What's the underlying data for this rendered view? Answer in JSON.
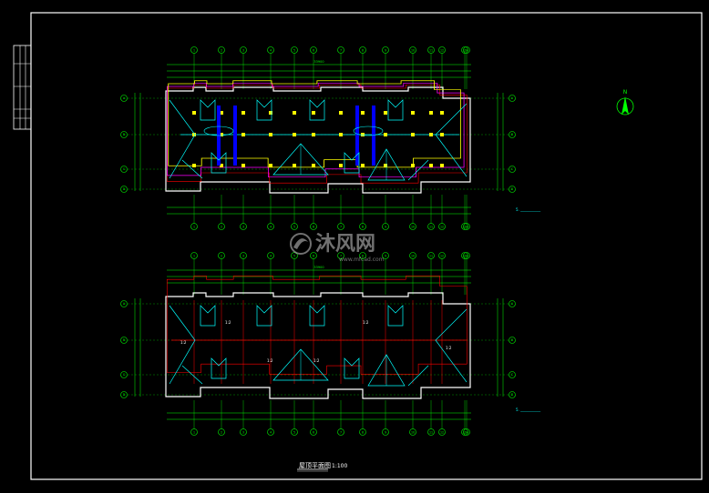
{
  "drawing": {
    "title": "屋顶平面图",
    "scale": "1:100",
    "north_label": "N"
  },
  "watermark": {
    "name": "沐风网",
    "url": "www.mfcad.com"
  },
  "plans": [
    {
      "id": "upper",
      "overall_width": "33900",
      "note": "5. ___________"
    },
    {
      "id": "lower",
      "overall_width": "33900",
      "note": "5. ___________"
    }
  ],
  "axes": {
    "columns": [
      "1",
      "2",
      "3",
      "4",
      "5",
      "6",
      "7",
      "8",
      "9",
      "10",
      "11",
      "12",
      "13",
      "14"
    ],
    "rows": [
      "A",
      "B",
      "C",
      "D"
    ]
  },
  "slope_labels": [
    "1:2",
    "1:2",
    "1:2",
    "1:2",
    "1:2",
    "1:2"
  ],
  "colors": {
    "background": "#000000",
    "border": "#ffffff",
    "dimension": "#00ff00",
    "outline": "#ffffff",
    "ridge": "#00ffff",
    "wall_red": "#ff0000",
    "parapet": "#ff00ff",
    "gutter": "#ffff00",
    "column_blue": "#0000ff",
    "note": "#00ffff"
  }
}
